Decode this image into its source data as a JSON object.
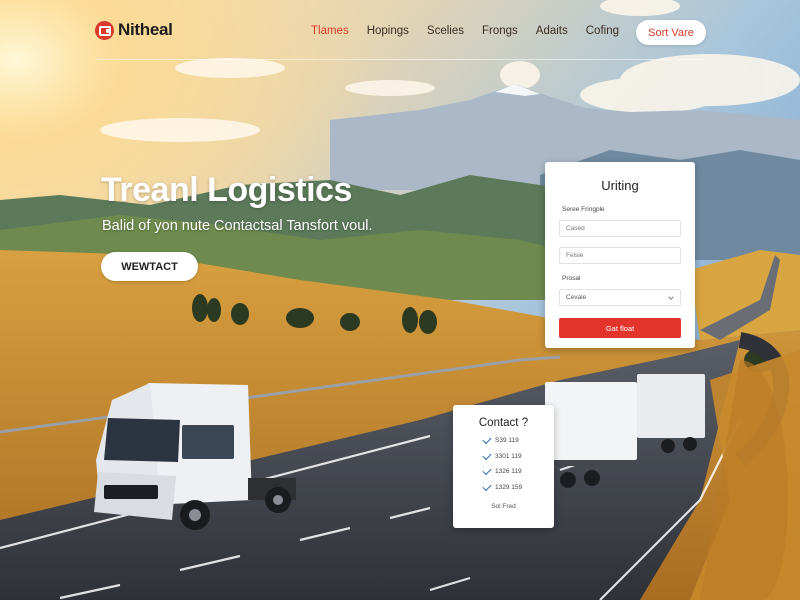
{
  "brand": {
    "name": "Nitheal",
    "logo_icon": "truck-badge-icon",
    "accent_color": "#d93a2b"
  },
  "nav": {
    "items": [
      {
        "label": "Tlames",
        "active": true
      },
      {
        "label": "Hopings",
        "active": false
      },
      {
        "label": "Scelies",
        "active": false
      },
      {
        "label": "Frongs",
        "active": false
      },
      {
        "label": "Adaits",
        "active": false
      },
      {
        "label": "Cofing",
        "active": false
      }
    ],
    "cta_label": "Sort Vare"
  },
  "hero": {
    "title": "Treanl Logistics",
    "subtitle": "Balid of yon nute Contactsal Tansfort voul.",
    "cta_label": "WEWTACT"
  },
  "form": {
    "title": "Uriting",
    "label_1": "Seree Fringple",
    "input_1_placeholder": "Cased",
    "input_2_placeholder": "Felsie",
    "label_2": "Prosal",
    "select_value": "Cevale",
    "submit_label": "Gat float",
    "submit_color": "#e2342d"
  },
  "contact": {
    "title": "Contact ?",
    "items": [
      "S39 119",
      "3301 119",
      "1326 119",
      "1329 159"
    ],
    "link_label": "Sol Fred"
  }
}
